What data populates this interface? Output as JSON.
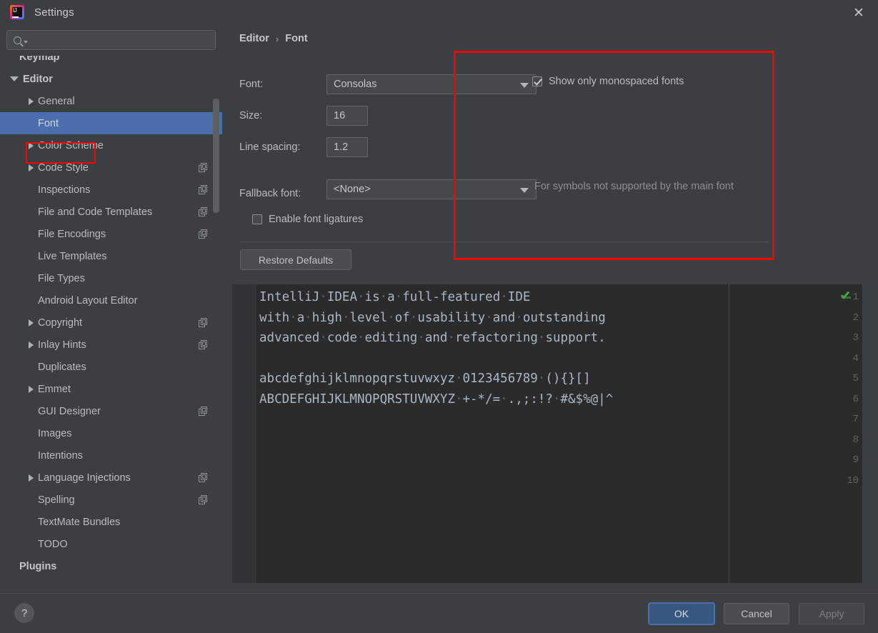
{
  "window": {
    "title": "Settings",
    "logo_text": "IJ",
    "close_icon": "✕"
  },
  "search": {
    "value": "",
    "placeholder": ""
  },
  "sidebar": {
    "items": [
      {
        "label": "Keymap",
        "indent": 0,
        "arrow": "none",
        "bold": true,
        "selected": false,
        "copy": false,
        "partial": true
      },
      {
        "label": "Editor",
        "indent": 0,
        "arrow": "open",
        "bold": true,
        "selected": false,
        "copy": false
      },
      {
        "label": "General",
        "indent": 1,
        "arrow": "closed",
        "bold": false,
        "selected": false,
        "copy": false
      },
      {
        "label": "Font",
        "indent": 1,
        "arrow": "none",
        "bold": false,
        "selected": true,
        "copy": false
      },
      {
        "label": "Color Scheme",
        "indent": 1,
        "arrow": "closed",
        "bold": false,
        "selected": false,
        "copy": false
      },
      {
        "label": "Code Style",
        "indent": 1,
        "arrow": "closed",
        "bold": false,
        "selected": false,
        "copy": true
      },
      {
        "label": "Inspections",
        "indent": 1,
        "arrow": "none",
        "bold": false,
        "selected": false,
        "copy": true
      },
      {
        "label": "File and Code Templates",
        "indent": 1,
        "arrow": "none",
        "bold": false,
        "selected": false,
        "copy": true
      },
      {
        "label": "File Encodings",
        "indent": 1,
        "arrow": "none",
        "bold": false,
        "selected": false,
        "copy": true
      },
      {
        "label": "Live Templates",
        "indent": 1,
        "arrow": "none",
        "bold": false,
        "selected": false,
        "copy": false
      },
      {
        "label": "File Types",
        "indent": 1,
        "arrow": "none",
        "bold": false,
        "selected": false,
        "copy": false
      },
      {
        "label": "Android Layout Editor",
        "indent": 1,
        "arrow": "none",
        "bold": false,
        "selected": false,
        "copy": false
      },
      {
        "label": "Copyright",
        "indent": 1,
        "arrow": "closed",
        "bold": false,
        "selected": false,
        "copy": true
      },
      {
        "label": "Inlay Hints",
        "indent": 1,
        "arrow": "closed",
        "bold": false,
        "selected": false,
        "copy": true
      },
      {
        "label": "Duplicates",
        "indent": 1,
        "arrow": "none",
        "bold": false,
        "selected": false,
        "copy": false
      },
      {
        "label": "Emmet",
        "indent": 1,
        "arrow": "closed",
        "bold": false,
        "selected": false,
        "copy": false
      },
      {
        "label": "GUI Designer",
        "indent": 1,
        "arrow": "none",
        "bold": false,
        "selected": false,
        "copy": true
      },
      {
        "label": "Images",
        "indent": 1,
        "arrow": "none",
        "bold": false,
        "selected": false,
        "copy": false
      },
      {
        "label": "Intentions",
        "indent": 1,
        "arrow": "none",
        "bold": false,
        "selected": false,
        "copy": false
      },
      {
        "label": "Language Injections",
        "indent": 1,
        "arrow": "closed",
        "bold": false,
        "selected": false,
        "copy": true
      },
      {
        "label": "Spelling",
        "indent": 1,
        "arrow": "none",
        "bold": false,
        "selected": false,
        "copy": true
      },
      {
        "label": "TextMate Bundles",
        "indent": 1,
        "arrow": "none",
        "bold": false,
        "selected": false,
        "copy": false
      },
      {
        "label": "TODO",
        "indent": 1,
        "arrow": "none",
        "bold": false,
        "selected": false,
        "copy": false
      },
      {
        "label": "Plugins",
        "indent": 0,
        "arrow": "none",
        "bold": true,
        "selected": false,
        "copy": false
      }
    ]
  },
  "breadcrumb": {
    "root": "Editor",
    "separator": "›",
    "current": "Font"
  },
  "form": {
    "font_label": "Font:",
    "font_value": "Consolas",
    "size_label": "Size:",
    "size_value": "16",
    "line_spacing_label": "Line spacing:",
    "line_spacing_value": "1.2",
    "fallback_label": "Fallback font:",
    "fallback_value": "<None>",
    "ligatures_label": "Enable font ligatures",
    "ligatures_checked": false,
    "monospaced_label": "Show only monospaced fonts",
    "monospaced_checked": true,
    "fallback_hint": "For symbols not supported by the main font",
    "restore_defaults_label": "Restore Defaults"
  },
  "preview": {
    "line_numbers": [
      "1",
      "2",
      "3",
      "4",
      "5",
      "6",
      "7",
      "8",
      "9",
      "10"
    ],
    "lines": [
      "IntelliJ IDEA is a full-featured IDE",
      "with a high level of usability and outstanding",
      "advanced code editing and refactoring support.",
      "",
      "abcdefghijklmnopqrstuvwxyz 0123456789 (){}[]",
      "ABCDEFGHIJKLMNOPQRSTUVWXYZ +-*/= .,;:!? #&$%@|^",
      "",
      "",
      "",
      ""
    ],
    "inspection_icon": "green-check"
  },
  "footer": {
    "help_label": "?",
    "ok_label": "OK",
    "cancel_label": "Cancel",
    "apply_label": "Apply"
  },
  "colors": {
    "window_bg": "#3c3f41",
    "selection_blue": "#4b6eaf",
    "highlight_red": "#ff0000",
    "editor_bg": "#2b2b2b",
    "code_text": "#a9b7c6",
    "ok_button": "#365880",
    "check_green": "#49a34a"
  }
}
